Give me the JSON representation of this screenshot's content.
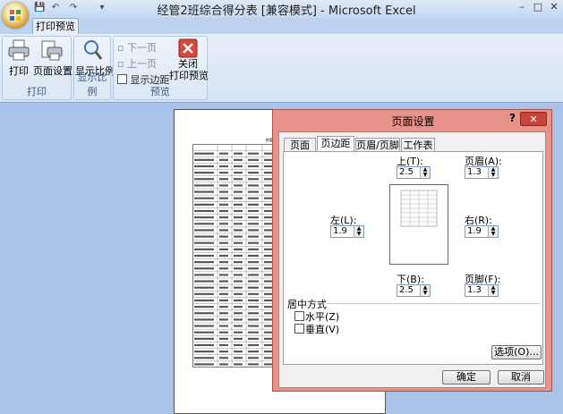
{
  "window": {
    "title": "经管2班综合得分表  [兼容模式] - Microsoft Excel",
    "min": "–",
    "max": "□",
    "close": "✕"
  },
  "quick_access": {
    "save": "💾",
    "undo": "↶",
    "redo": "↷",
    "more": "▾"
  },
  "ribbon": {
    "tab": "打印预览",
    "groups": {
      "print": {
        "label": "打印",
        "print_button": "打印",
        "page_setup_button": "页面设置"
      },
      "zoom": {
        "label": "显示比例",
        "zoom_button": "显示比例"
      },
      "preview": {
        "label": "预览",
        "next_page": "下一页",
        "prev_page": "上一页",
        "show_margins": "显示边距",
        "close_line1": "关闭",
        "close_line2": "打印预览"
      }
    }
  },
  "page": {
    "title": "经管2班综合得分统计表",
    "rows": 35
  },
  "dialog": {
    "title": "页面设置",
    "help": "?",
    "close": "✕",
    "tabs": [
      "页面",
      "页边距",
      "页眉/页脚",
      "工作表"
    ],
    "active_tab": "页边距",
    "margins": {
      "top_label": "上(T):",
      "top_value": "2.5",
      "header_label": "页眉(A):",
      "header_value": "1.3",
      "left_label": "左(L):",
      "left_value": "1.9",
      "right_label": "右(R):",
      "right_value": "1.9",
      "bottom_label": "下(B):",
      "bottom_value": "2.5",
      "footer_label": "页脚(F):",
      "footer_value": "1.3"
    },
    "center": {
      "title": "居中方式",
      "horizontal": "水平(Z)",
      "vertical": "垂直(V)"
    },
    "options_button": "选项(O)...",
    "ok_button": "确定",
    "cancel_button": "取消"
  },
  "colors": {
    "workspace": "#a9c3e8",
    "dialog_frame": "#e7938a",
    "close_red": "#c7443b"
  }
}
